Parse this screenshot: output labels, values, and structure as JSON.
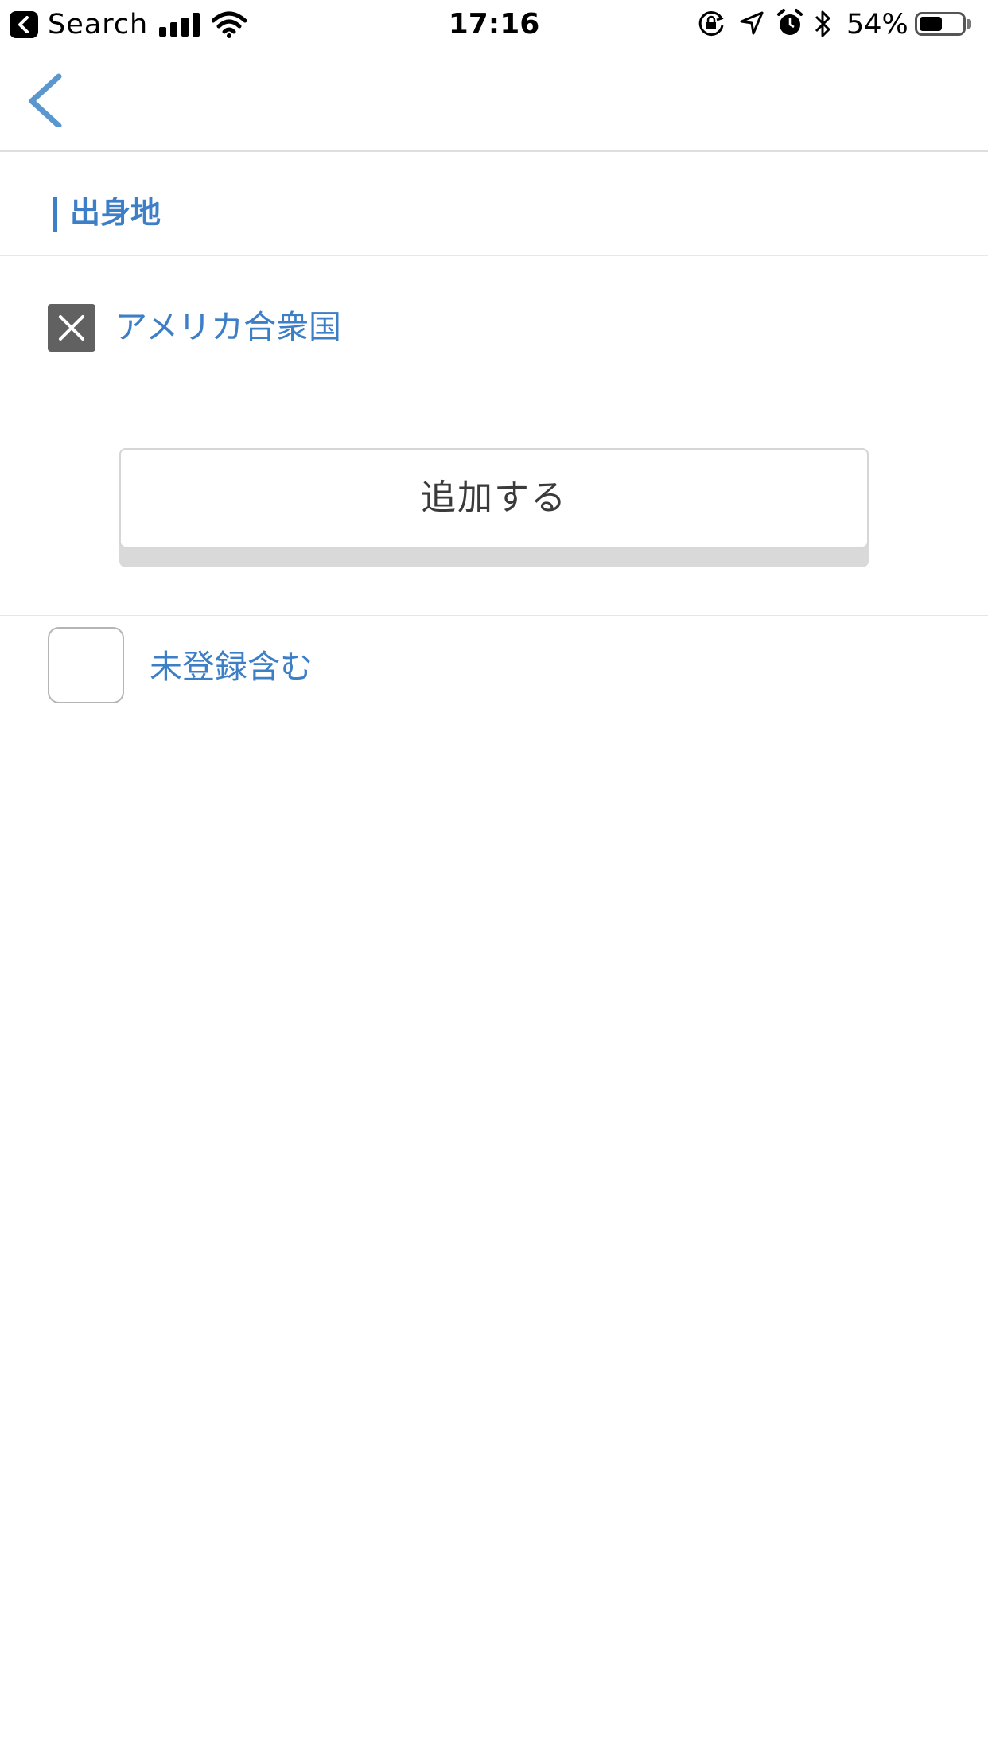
{
  "status_bar": {
    "back_app_label": "Search",
    "time": "17:16",
    "battery_percent": "54%",
    "battery_level": 0.54,
    "signal_bars": 4,
    "icons": [
      "back-arrow-icon",
      "signal-icon",
      "wifi-icon",
      "orientation-lock-icon",
      "location-icon",
      "alarm-icon",
      "bluetooth-icon",
      "battery-icon"
    ]
  },
  "nav": {
    "back_icon": "chevron-left-icon"
  },
  "section": {
    "title": "出身地"
  },
  "selected": {
    "items": [
      {
        "label": "アメリカ合衆国",
        "remove_icon": "close-icon"
      }
    ]
  },
  "actions": {
    "add_label": "追加する"
  },
  "filter": {
    "include_unregistered_label": "未登録含む",
    "checked": false
  },
  "colors": {
    "accent": "#3d7fc6",
    "remove_chip": "#616161",
    "button_shadow": "#d9d9d9",
    "divider": "#e6e6e6"
  }
}
